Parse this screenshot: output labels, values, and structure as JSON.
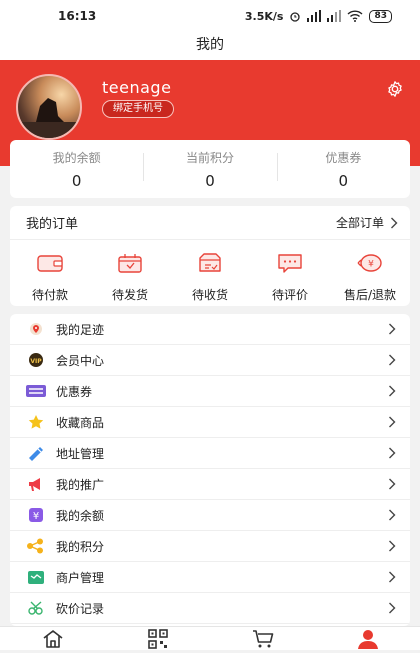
{
  "status_bar": {
    "time": "16:13",
    "network_speed": "3.5K/s",
    "battery": "83"
  },
  "header": {
    "title": "我的"
  },
  "profile": {
    "username": "teenage",
    "bind_phone_label": "绑定手机号"
  },
  "stats": [
    {
      "label": "我的余额",
      "value": "0"
    },
    {
      "label": "当前积分",
      "value": "0"
    },
    {
      "label": "优惠券",
      "value": "0"
    }
  ],
  "orders": {
    "title": "我的订单",
    "all_label": "全部订单",
    "tabs": [
      {
        "label": "待付款",
        "icon": "wallet-icon"
      },
      {
        "label": "待发货",
        "icon": "package-icon"
      },
      {
        "label": "待收货",
        "icon": "receive-box-icon"
      },
      {
        "label": "待评价",
        "icon": "comment-icon"
      },
      {
        "label": "售后/退款",
        "icon": "refund-icon"
      }
    ]
  },
  "menu": [
    {
      "label": "我的足迹",
      "icon": "footprint-icon"
    },
    {
      "label": "会员中心",
      "icon": "vip-icon"
    },
    {
      "label": "优惠券",
      "icon": "coupon-icon"
    },
    {
      "label": "收藏商品",
      "icon": "favorite-star-icon"
    },
    {
      "label": "地址管理",
      "icon": "address-icon"
    },
    {
      "label": "我的推广",
      "icon": "promotion-icon"
    },
    {
      "label": "我的余额",
      "icon": "balance-yen-icon"
    },
    {
      "label": "我的积分",
      "icon": "points-icon"
    },
    {
      "label": "商户管理",
      "icon": "merchant-icon"
    },
    {
      "label": "砍价记录",
      "icon": "bargain-icon"
    }
  ],
  "colors": {
    "accent": "#e83a2f",
    "background": "#f2f2f2"
  },
  "tab_bar": [
    {
      "icon": "home-icon"
    },
    {
      "icon": "qr-code-icon"
    },
    {
      "icon": "cart-icon"
    },
    {
      "icon": "user-icon",
      "active": true
    }
  ]
}
